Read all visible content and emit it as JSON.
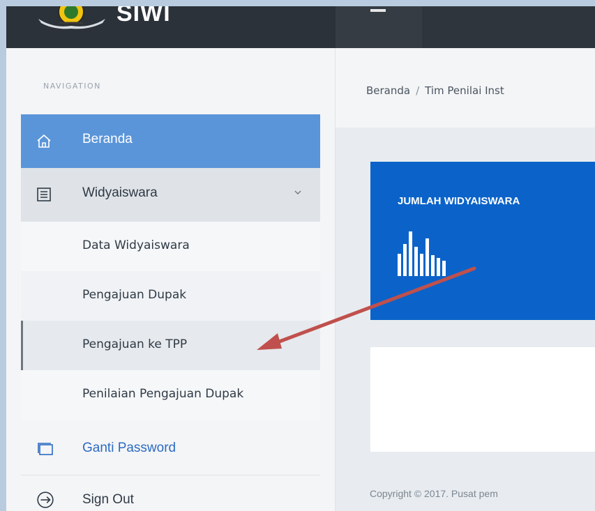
{
  "header": {
    "app_name": "SIWI"
  },
  "sidebar": {
    "heading": "NAVIGATION",
    "items": [
      {
        "label": "Beranda",
        "icon": "home-icon"
      },
      {
        "label": "Widyaiswara",
        "icon": "document-list-icon"
      },
      {
        "label": "Ganti Password",
        "icon": "window-icon"
      },
      {
        "label": "Sign Out",
        "icon": "sign-out-icon"
      }
    ],
    "submenu": [
      {
        "label": "Data Widyaiswara"
      },
      {
        "label": "Pengajuan Dupak"
      },
      {
        "label": "Pengajuan ke TPP"
      },
      {
        "label": "Penilaian Pengajuan Dupak"
      }
    ]
  },
  "main": {
    "breadcrumb": {
      "home": "Beranda",
      "separator": "/",
      "current": "Tim Penilai Inst"
    },
    "stat_card": {
      "title": "JUMLAH WIDYAISWARA",
      "icon": "bar-chart-icon"
    },
    "footer": "Copyright © 2017. Pusat pem"
  },
  "colors": {
    "topbar": "#262c33",
    "active": "#5b95d9",
    "card": "#0b63c9",
    "link": "#2c6bc2",
    "arrow": "#c0504d"
  }
}
